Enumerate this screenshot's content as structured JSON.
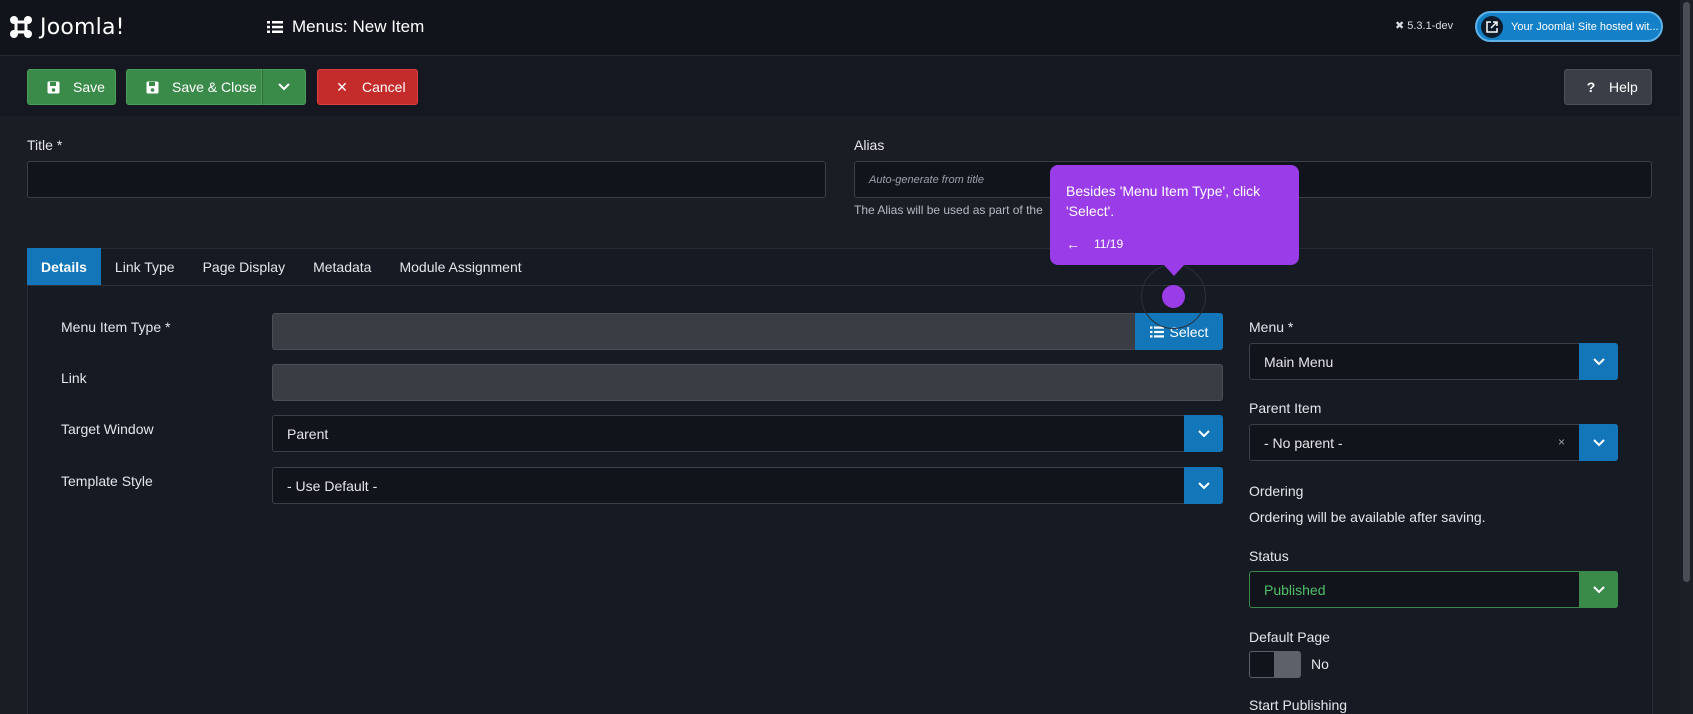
{
  "header": {
    "brand": "Joomla!",
    "page_title": "Menus: New Item",
    "version": "5.3.1-dev",
    "site_link": "Your Joomla! Site hosted wit..."
  },
  "toolbar": {
    "save": "Save",
    "save_close": "Save & Close",
    "cancel": "Cancel",
    "help": "Help"
  },
  "form": {
    "title_label": "Title *",
    "alias_label": "Alias",
    "alias_placeholder": "Auto-generate from title",
    "alias_hint": "The Alias will be used as part of the"
  },
  "tabs": [
    "Details",
    "Link Type",
    "Page Display",
    "Metadata",
    "Module Assignment"
  ],
  "details": {
    "menu_item_type_label": "Menu Item Type *",
    "select_label": "Select",
    "link_label": "Link",
    "target_window_label": "Target Window",
    "target_window_value": "Parent",
    "template_style_label": "Template Style",
    "template_style_value": "- Use Default -"
  },
  "sidebar": {
    "menu_label": "Menu *",
    "menu_value": "Main Menu",
    "parent_item_label": "Parent Item",
    "parent_item_value": "- No parent -",
    "ordering_label": "Ordering",
    "ordering_hint": "Ordering will be available after saving.",
    "status_label": "Status",
    "status_value": "Published",
    "default_page_label": "Default Page",
    "default_page_value": "No",
    "start_publishing_label": "Start Publishing"
  },
  "tooltip": {
    "text": "Besides 'Menu Item Type', click 'Select'.",
    "step": "11/19"
  },
  "colors": {
    "accent_blue": "#1376b8",
    "save_green": "#3a8a4a",
    "cancel_red": "#c42b2b",
    "tooltip_purple": "#9a3de8",
    "published_green": "#4fbf6a"
  }
}
